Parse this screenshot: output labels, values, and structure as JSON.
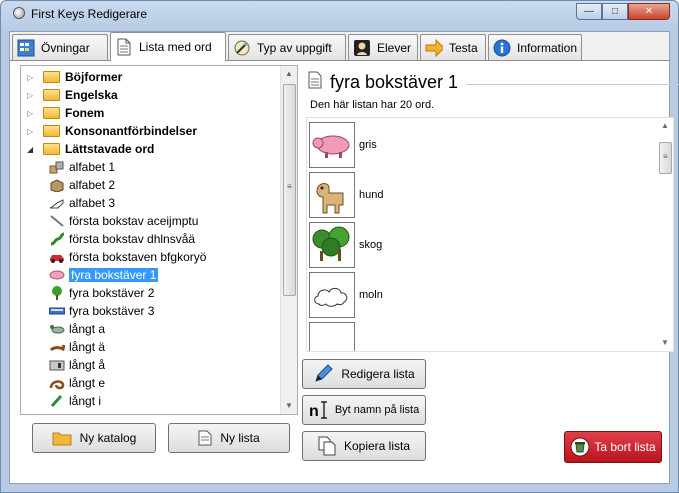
{
  "window": {
    "title": "First Keys Redigerare",
    "min_label": "—",
    "max_label": "□",
    "close_label": "✕"
  },
  "tabs": [
    {
      "label": "Övningar",
      "icon": "grid-icon"
    },
    {
      "label": "Lista med ord",
      "icon": "document-icon"
    },
    {
      "label": "Typ av uppgift",
      "icon": "tools-icon"
    },
    {
      "label": "Elever",
      "icon": "student-icon"
    },
    {
      "label": "Testa",
      "icon": "arrow-right-icon"
    },
    {
      "label": "Information",
      "icon": "info-icon"
    }
  ],
  "active_tab": "Lista med ord",
  "tree": {
    "folders": [
      {
        "label": "Böjformer",
        "expanded": false
      },
      {
        "label": "Engelska",
        "expanded": false
      },
      {
        "label": "Fonem",
        "expanded": false
      },
      {
        "label": "Konsonantförbindelser",
        "expanded": false
      },
      {
        "label": "Lättstavade ord",
        "expanded": true
      }
    ],
    "items": [
      {
        "label": "alfabet 1",
        "icon": "blocks-icon"
      },
      {
        "label": "alfabet 2",
        "icon": "box-icon"
      },
      {
        "label": "alfabet 3",
        "icon": "hand-icon"
      },
      {
        "label": "första bokstav aceijmptu",
        "icon": "pencil-icon"
      },
      {
        "label": "första bokstav dhlnsvåä",
        "icon": "snake-icon"
      },
      {
        "label": "första bokstaven bfgkoryö",
        "icon": "car-icon"
      },
      {
        "label": "fyra bokstäver 1",
        "icon": "pig-icon",
        "selected": true
      },
      {
        "label": "fyra bokstäver 2",
        "icon": "tree-icon"
      },
      {
        "label": "fyra bokstäver 3",
        "icon": "bus-icon"
      },
      {
        "label": "långt a",
        "icon": "goat-icon"
      },
      {
        "label": "långt ä",
        "icon": "deer-icon"
      },
      {
        "label": "långt å",
        "icon": "boat-icon"
      },
      {
        "label": "långt e",
        "icon": "rope-icon"
      },
      {
        "label": "långt i",
        "icon": "leaf-icon"
      }
    ]
  },
  "left_buttons": {
    "new_folder": "Ny katalog",
    "new_list": "Ny lista"
  },
  "list_panel": {
    "title": "fyra bokstäver 1",
    "count_text": "Den här listan har 20 ord.",
    "words": [
      {
        "word": "gris",
        "icon": "pig-icon"
      },
      {
        "word": "hund",
        "icon": "dog-icon"
      },
      {
        "word": "skog",
        "icon": "forest-icon"
      },
      {
        "word": "moln",
        "icon": "cloud-icon"
      }
    ],
    "buttons": {
      "edit": "Redigera lista",
      "rename": "Byt namn på lista",
      "copy": "Kopiera lista",
      "delete": "Ta bort lista"
    }
  },
  "colors": {
    "selection": "#3399ff",
    "delete_button": "#d22630",
    "folder": "#f2b739"
  }
}
